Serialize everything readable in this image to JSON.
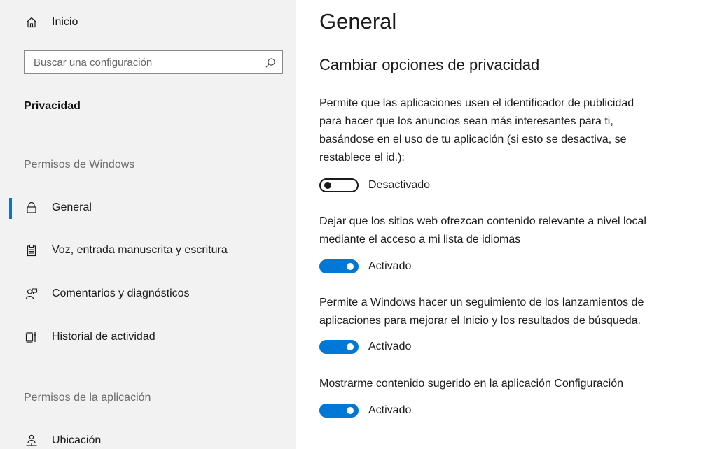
{
  "sidebar": {
    "home_label": "Inicio",
    "search_placeholder": "Buscar una configuración",
    "category_title": "Privacidad",
    "section_windows": "Permisos de Windows",
    "items": [
      {
        "label": "General",
        "icon": "lock-icon",
        "active": true
      },
      {
        "label": "Voz, entrada manuscrita y escritura",
        "icon": "clipboard-icon"
      },
      {
        "label": "Comentarios y diagnósticos",
        "icon": "feedback-person-icon"
      },
      {
        "label": "Historial de actividad",
        "icon": "timeline-icon"
      }
    ],
    "section_app": "Permisos de la aplicación",
    "app_items": [
      {
        "label": "Ubicación",
        "icon": "location-person-icon"
      }
    ]
  },
  "main": {
    "title": "General",
    "subtitle": "Cambiar opciones de privacidad",
    "settings": [
      {
        "lines": [
          "Permite que las aplicaciones usen el identificador de publicidad",
          "para hacer que los anuncios sean más interesantes para ti,",
          "basándose en el uso de tu aplicación (si esto se desactiva, se",
          "restablece el id.):"
        ],
        "state": "Desactivado",
        "on": false
      },
      {
        "lines": [
          "Dejar que los sitios web ofrezcan contenido relevante a nivel local",
          "mediante el acceso a mi lista de idiomas"
        ],
        "state": "Activado",
        "on": true
      },
      {
        "lines": [
          "Permite a Windows hacer un seguimiento de los lanzamientos de",
          "aplicaciones para mejorar el Inicio y los resultados de búsqueda."
        ],
        "state": "Activado",
        "on": true
      },
      {
        "lines": [
          "Mostrarme contenido sugerido en la aplicación Configuración"
        ],
        "state": "Activado",
        "on": true
      }
    ]
  },
  "colors": {
    "accent": "#0078d7",
    "sidebar_bg": "#f2f2f2"
  }
}
